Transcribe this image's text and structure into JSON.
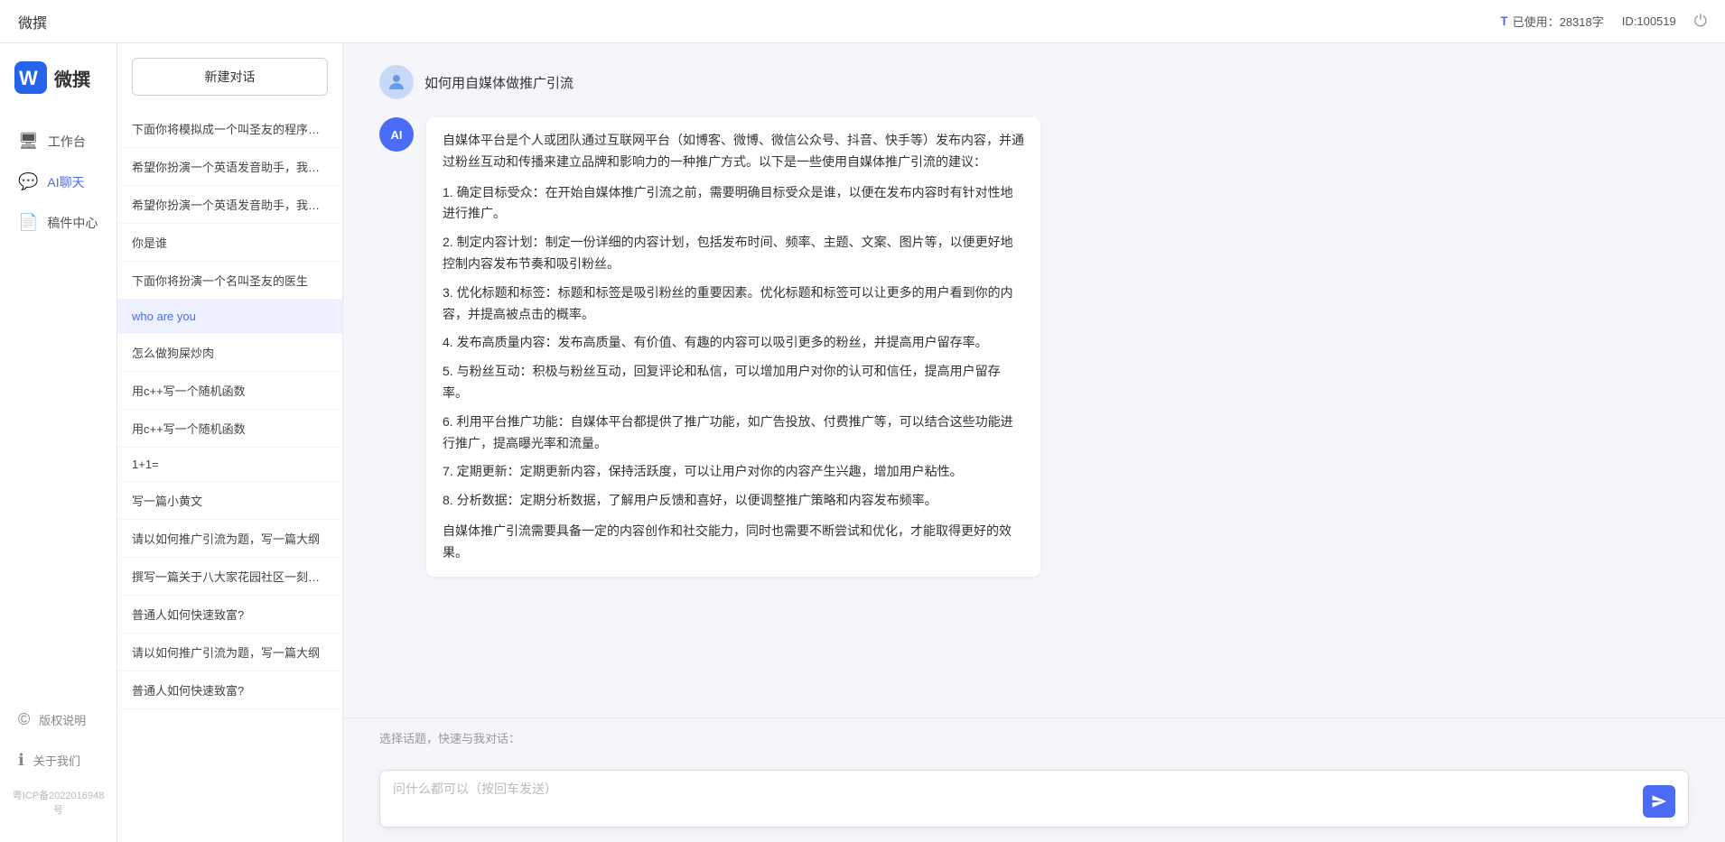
{
  "topbar": {
    "title": "微撰",
    "chars_label": "已使用：28318字",
    "id_label": "ID:100519",
    "chars_icon": "font-icon"
  },
  "left_nav": {
    "logo_text": "微撰",
    "items": [
      {
        "id": "workspace",
        "label": "工作台",
        "icon": "🖥"
      },
      {
        "id": "ai-chat",
        "label": "AI聊天",
        "icon": "💬",
        "active": true
      },
      {
        "id": "drafts",
        "label": "稿件中心",
        "icon": "📄"
      }
    ],
    "bottom_items": [
      {
        "id": "copyright",
        "label": "版权说明",
        "icon": "©"
      },
      {
        "id": "about",
        "label": "关于我们",
        "icon": "ℹ"
      }
    ],
    "icp": "粤ICP备2022016948号"
  },
  "conv_panel": {
    "new_btn_label": "新建对话",
    "conversations": [
      {
        "id": 1,
        "text": "下面你将模拟成一个叫圣友的程序员，我说..."
      },
      {
        "id": 2,
        "text": "希望你扮演一个英语发音助手，我提供给你..."
      },
      {
        "id": 3,
        "text": "希望你扮演一个英语发音助手，我提供给你..."
      },
      {
        "id": 4,
        "text": "你是谁",
        "section": true
      },
      {
        "id": 5,
        "text": "下面你将扮演一个名叫圣友的医生"
      },
      {
        "id": 6,
        "text": "who are you",
        "active": true
      },
      {
        "id": 7,
        "text": "怎么做狗屎炒肉"
      },
      {
        "id": 8,
        "text": "用c++写一个随机函数"
      },
      {
        "id": 9,
        "text": "用c++写一个随机函数"
      },
      {
        "id": 10,
        "text": "1+1="
      },
      {
        "id": 11,
        "text": "写一篇小黄文"
      },
      {
        "id": 12,
        "text": "请以如何推广引流为题，写一篇大纲"
      },
      {
        "id": 13,
        "text": "撰写一篇关于八大家花园社区一刻钟便民生..."
      },
      {
        "id": 14,
        "text": "普通人如何快速致富?"
      },
      {
        "id": 15,
        "text": "请以如何推广引流为题，写一篇大纲"
      },
      {
        "id": 16,
        "text": "普通人如何快速致富?"
      }
    ]
  },
  "chat": {
    "user_question": "如何用自媒体做推广引流",
    "ai_response": {
      "paragraphs": [
        "自媒体平台是个人或团队通过互联网平台（如博客、微博、微信公众号、抖音、快手等）发布内容，并通过粉丝互动和传播来建立品牌和影响力的一种推广方式。以下是一些使用自媒体推广引流的建议：",
        "1. 确定目标受众：在开始自媒体推广引流之前，需要明确目标受众是谁，以便在发布内容时有针对性地进行推广。",
        "2. 制定内容计划：制定一份详细的内容计划，包括发布时间、频率、主题、文案、图片等，以便更好地控制内容发布节奏和吸引粉丝。",
        "3. 优化标题和标签：标题和标签是吸引粉丝的重要因素。优化标题和标签可以让更多的用户看到你的内容，并提高被点击的概率。",
        "4. 发布高质量内容：发布高质量、有价值、有趣的内容可以吸引更多的粉丝，并提高用户留存率。",
        "5. 与粉丝互动：积极与粉丝互动，回复评论和私信，可以增加用户对你的认可和信任，提高用户留存率。",
        "6. 利用平台推广功能：自媒体平台都提供了推广功能，如广告投放、付费推广等，可以结合这些功能进行推广，提高曝光率和流量。",
        "7. 定期更新：定期更新内容，保持活跃度，可以让用户对你的内容产生兴趣，增加用户粘性。",
        "8. 分析数据：定期分析数据，了解用户反馈和喜好，以便调整推广策略和内容发布频率。",
        "自媒体推广引流需要具备一定的内容创作和社交能力，同时也需要不断尝试和优化，才能取得更好的效果。"
      ]
    }
  },
  "quick_topics": {
    "label": "选择话题，快速与我对话：",
    "chips": []
  },
  "input": {
    "placeholder": "问什么都可以（按回车发送）",
    "value": ""
  }
}
